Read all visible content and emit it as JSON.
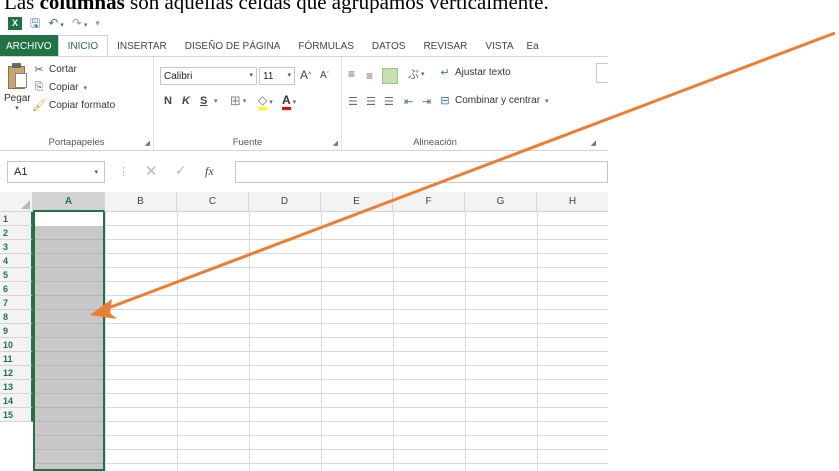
{
  "caption": {
    "before": "Las ",
    "bold": "columnas",
    "after": " son aquellas celdas que agrupamos verticalmente."
  },
  "quick_access": {
    "app_icon": "excel-logo",
    "save_icon": "save-icon",
    "undo_icon": "undo-icon",
    "redo_icon": "redo-icon",
    "customize_icon": "customize-icon"
  },
  "tabs": [
    {
      "label": "ARCHIVO"
    },
    {
      "label": "INICIO"
    },
    {
      "label": "INSERTAR"
    },
    {
      "label": "DISEÑO DE PÁGINA"
    },
    {
      "label": "FÓRMULAS"
    },
    {
      "label": "DATOS"
    },
    {
      "label": "REVISAR"
    },
    {
      "label": "VISTA"
    },
    {
      "label": "Ea"
    }
  ],
  "ribbon": {
    "clipboard": {
      "paste_label": "Pegar",
      "cut_label": "Cortar",
      "copy_label": "Copiar",
      "format_painter_label": "Copiar formato",
      "group_label": "Portapapeles"
    },
    "font": {
      "font_name": "Calibri",
      "font_size": "11",
      "bold": "N",
      "italic": "K",
      "underline": "S",
      "grow_label": "A",
      "shrink_label": "A",
      "font_color_label": "A",
      "group_label": "Fuente"
    },
    "alignment": {
      "wrap_text_label": "Ajustar texto",
      "merge_label": "Combinar y centrar",
      "group_label": "Alineación"
    }
  },
  "formula_bar": {
    "name_box": "A1",
    "fx_label": "fx",
    "value": ""
  },
  "grid": {
    "columns": [
      "A",
      "B",
      "C",
      "D",
      "E",
      "F",
      "G",
      "H"
    ],
    "rows": [
      "1",
      "2",
      "3",
      "4",
      "5",
      "6",
      "7",
      "8",
      "9",
      "10",
      "11",
      "12",
      "13",
      "14",
      "15"
    ],
    "selected_column": "A",
    "active_cell": "A1"
  },
  "annotation": {
    "arrow_color": "#ED7D31"
  },
  "colors": {
    "excel_green": "#217346",
    "selection_gray": "#c8c8c8"
  }
}
